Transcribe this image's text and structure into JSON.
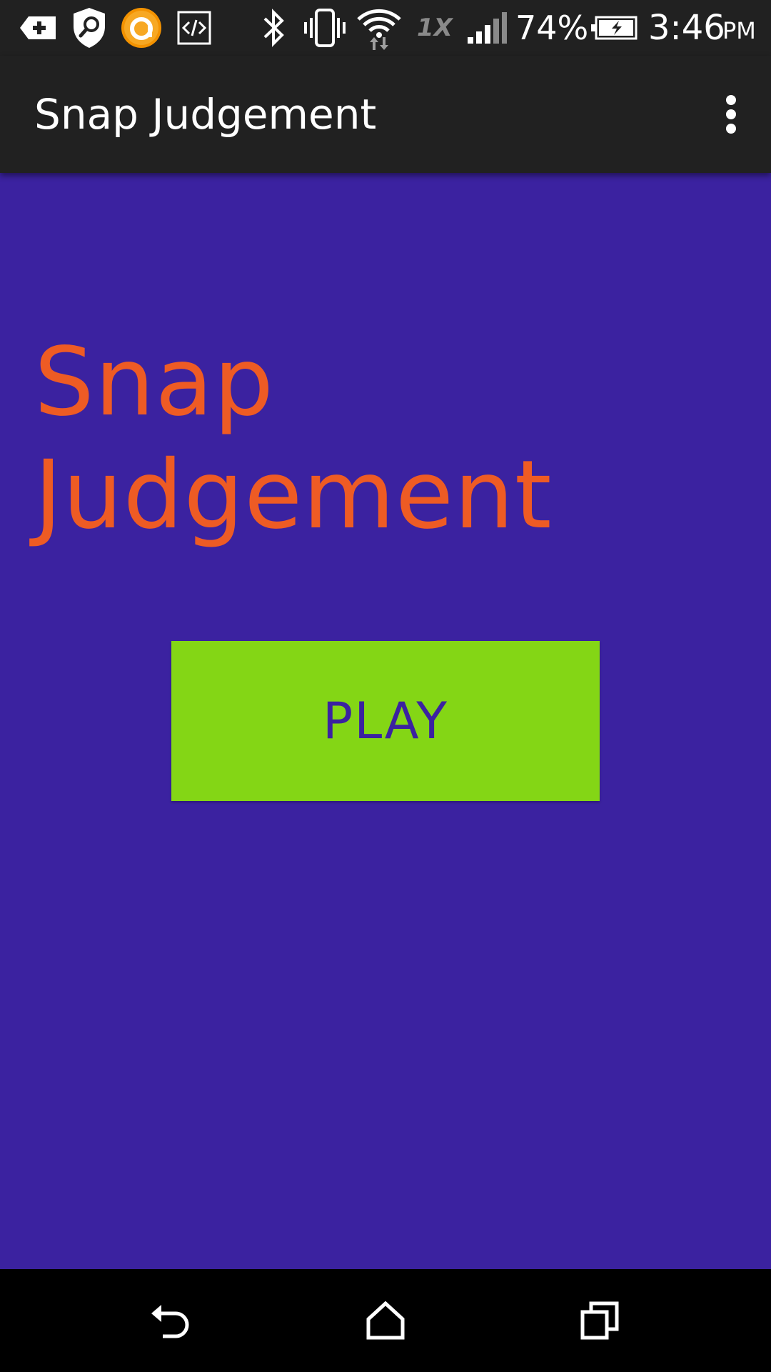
{
  "status_bar": {
    "network_type": "1X",
    "battery_percent": "74%",
    "time": "3:46",
    "meridiem": "PM",
    "icons": [
      "add-notification-icon",
      "shield-search-icon",
      "orange-app-icon",
      "code-icon",
      "bluetooth-icon",
      "vibrate-icon",
      "wifi-icon",
      "signal-icon",
      "battery-charging-icon"
    ]
  },
  "app_bar": {
    "title": "Snap Judgement",
    "overflow_icon": "more-vert-icon"
  },
  "main": {
    "title_line1": "Snap",
    "title_line2": "Judgement",
    "play_label": "PLAY"
  },
  "nav_bar": {
    "icons": [
      "back-icon",
      "home-icon",
      "recents-icon"
    ]
  },
  "colors": {
    "background": "#3b22a0",
    "title": "#ee5b24",
    "button": "#84d615",
    "button_text": "#3b22a0",
    "toolbar": "#212121"
  }
}
